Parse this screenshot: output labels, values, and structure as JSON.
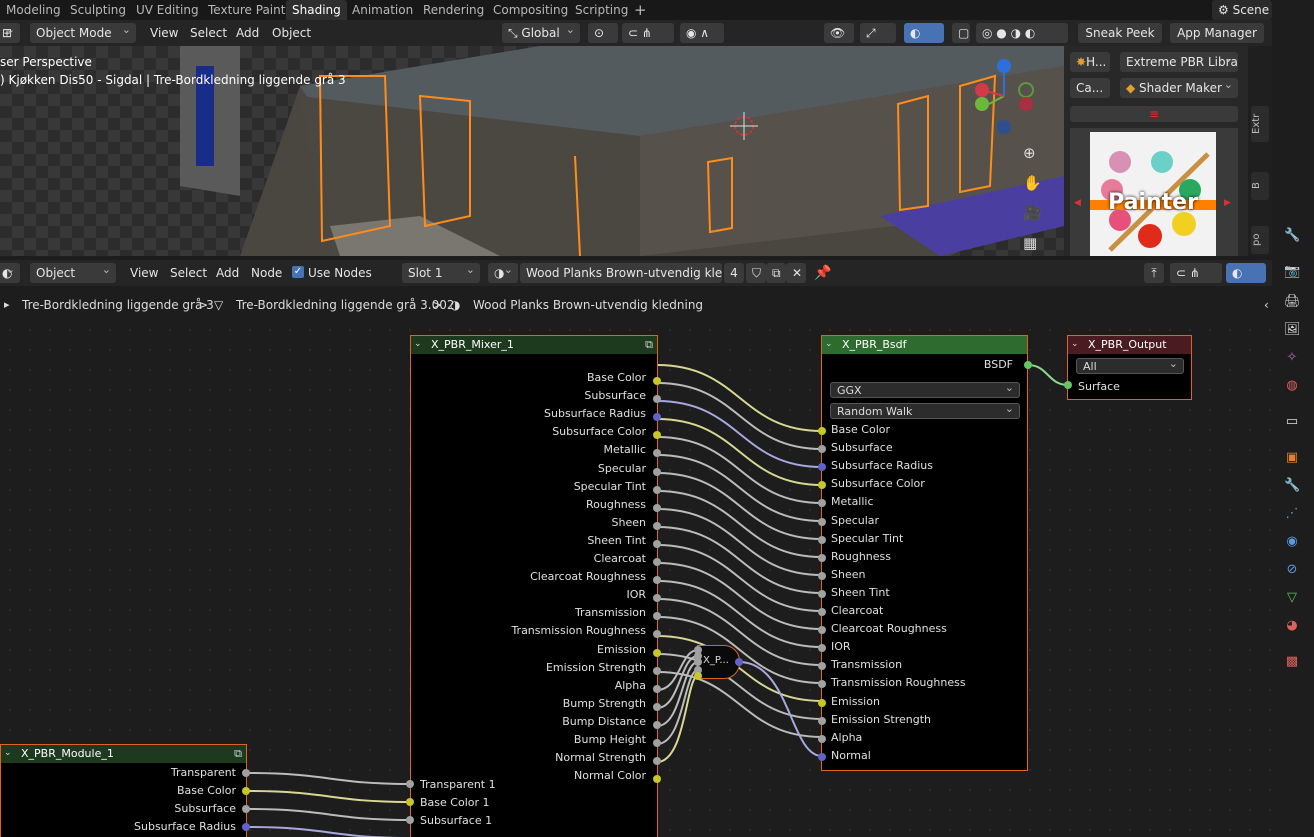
{
  "workspace_tabs": [
    "Modeling",
    "Sculpting",
    "UV Editing",
    "Texture Paint",
    "Shading",
    "Animation",
    "Rendering",
    "Compositing",
    "Scripting"
  ],
  "active_tab": "Shading",
  "scene": "Scene",
  "viewport_header": {
    "mode": "Object Mode",
    "menus": [
      "View",
      "Select",
      "Add",
      "Object"
    ],
    "orientation": "Global",
    "sneak_peek": "Sneak Peek",
    "app_manager": "App Manager"
  },
  "viewport": {
    "line1": "ser Perspective",
    "line2": ") Kjøkken Dis50 - Sigdal | Tre-Bordkledning liggende grå 3"
  },
  "npanel": {
    "h_label": "H...",
    "extreme": "Extreme PBR Libra...",
    "ca_label": "Ca...",
    "shader_maker": "Shader Maker",
    "painter": "Painter",
    "tabs": [
      "Extr",
      "B",
      "po"
    ]
  },
  "node_header": {
    "mode": "Object",
    "menus": [
      "View",
      "Select",
      "Add",
      "Node"
    ],
    "use_nodes": "Use Nodes",
    "slot": "Slot 1",
    "material": "Wood Planks Brown-utvendig kledning",
    "users": "4"
  },
  "breadcrumb": [
    "Tre-Bordkledning liggende grå 3",
    "Tre-Bordkledning liggende grå 3.002",
    "Wood Planks Brown-utvendig kledning"
  ],
  "mixer": {
    "title": "X_PBR_Mixer_1",
    "outputs": [
      "Base Color",
      "Subsurface",
      "Subsurface Radius",
      "Subsurface Color",
      "Metallic",
      "Specular",
      "Specular Tint",
      "Roughness",
      "Sheen",
      "Sheen Tint",
      "Clearcoat",
      "Clearcoat Roughness",
      "IOR",
      "Transmission",
      "Transmission Roughness",
      "Emission",
      "Emission Strength",
      "Alpha",
      "Bump Strength",
      "Bump Distance",
      "Bump Height",
      "Normal Strength",
      "Normal Color"
    ],
    "inputs": [
      "Transparent 1",
      "Base Color 1",
      "Subsurface 1"
    ]
  },
  "bsdf": {
    "title": "X_PBR_Bsdf",
    "output": "BSDF",
    "distribution": "GGX",
    "subsurface_method": "Random Walk",
    "inputs": [
      "Base Color",
      "Subsurface",
      "Subsurface Radius",
      "Subsurface Color",
      "Metallic",
      "Specular",
      "Specular Tint",
      "Roughness",
      "Sheen",
      "Sheen Tint",
      "Clearcoat",
      "Clearcoat Roughness",
      "IOR",
      "Transmission",
      "Transmission Roughness",
      "Emission",
      "Emission Strength",
      "Alpha",
      "Normal"
    ]
  },
  "output_node": {
    "title": "X_PBR_Output",
    "target": "All",
    "input": "Surface"
  },
  "module": {
    "title": "X_PBR_Module_1",
    "outputs": [
      "Transparent",
      "Base Color",
      "Subsurface",
      "Subsurface Radius"
    ]
  },
  "group_node": {
    "label": "X_P..."
  },
  "colors": {
    "accent": "#e0631e",
    "node_header": "#3a5a2a",
    "output_header": "#4a1c22",
    "socket_color": "#c7c729",
    "socket_vector": "#6363c7",
    "socket_shader": "#63c763",
    "socket_float": "#a1a1a1"
  }
}
